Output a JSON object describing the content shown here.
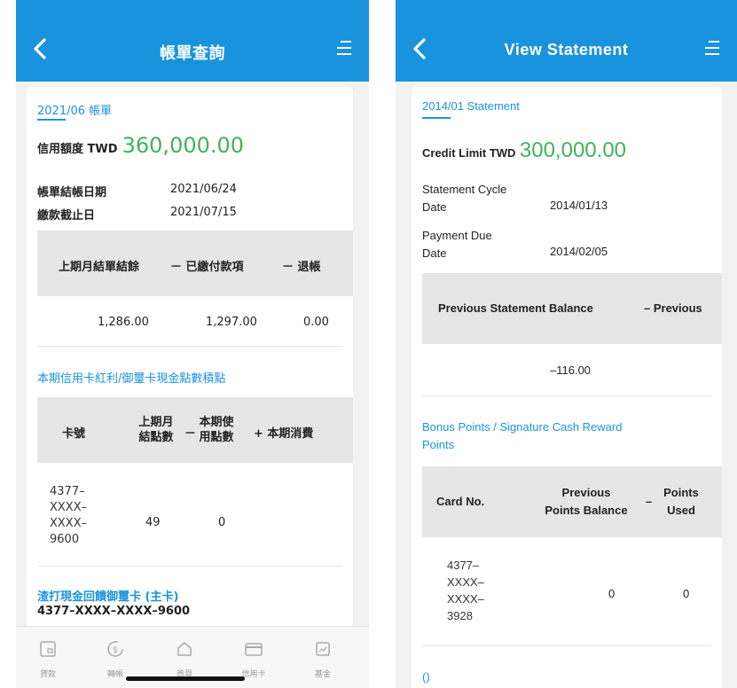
{
  "left": {
    "header": {
      "title": "帳單查詢",
      "back_icon": "chevron-left-icon",
      "menu_icon": "menu-icon"
    },
    "statement_month": "2021/06 帳單",
    "credit_limit": {
      "label": "信用額度 TWD",
      "value": "360,000.00"
    },
    "statement_date": {
      "label": "帳單結帳日期",
      "value": "2021/06/24"
    },
    "due_date": {
      "label": "繳款截止日",
      "value": "2021/07/15"
    },
    "balance_table": {
      "headers": [
        "上期月結單結餘",
        "－ 已繳付款項",
        "－ 退帳"
      ],
      "values": [
        "1,286.00",
        "1,297.00",
        "0.00"
      ]
    },
    "bonus_title": "本期信用卡紅利/御璽卡現金點數積點",
    "points_table": {
      "headers": [
        "卡號",
        "上期月結點數",
        "－",
        "本期使用點數",
        "+ 本期消費"
      ],
      "card_no": [
        "4377–",
        "XXXX–",
        "XXXX–",
        "9600"
      ],
      "previous": "49",
      "used": "0"
    },
    "card_name": "渣打現金回饋御璽卡 (主卡)",
    "card_number": "4377–XXXX–XXXX–9600",
    "tabbar": [
      {
        "label": "貸款",
        "icon": "loan-icon"
      },
      {
        "label": "轉帳",
        "icon": "transfer-icon"
      },
      {
        "label": "首頁",
        "icon": "home-icon"
      },
      {
        "label": "信用卡",
        "icon": "credit-card-icon"
      },
      {
        "label": "基金",
        "icon": "fund-icon"
      }
    ]
  },
  "right": {
    "header": {
      "title": "View Statement",
      "back_icon": "chevron-left-icon",
      "menu_icon": "menu-icon"
    },
    "statement_month": "2014/01 Statement",
    "credit_limit": {
      "label": "Credit Limit TWD",
      "value": "300,000.00"
    },
    "statement_date": {
      "label_line1": "Statement Cycle",
      "label_line2": "Date",
      "value": "2014/01/13"
    },
    "due_date": {
      "label_line1": "Payment Due",
      "label_line2": "Date",
      "value": "2014/02/05"
    },
    "balance_table": {
      "headers": [
        "Previous Statement Balance",
        "– Previous"
      ],
      "values": [
        "–116.00"
      ]
    },
    "bonus_title_line1": "Bonus Points / Signature Cash Reward",
    "bonus_title_line2": "Points",
    "points_table": {
      "headers": [
        "Card No.",
        "Previous",
        "Points Balance",
        "–",
        "Points",
        "Used"
      ],
      "card_no": [
        "4377–",
        "XXXX–",
        "XXXX–",
        "3928"
      ],
      "previous": "0",
      "used": "0"
    },
    "footer_text": "()"
  }
}
